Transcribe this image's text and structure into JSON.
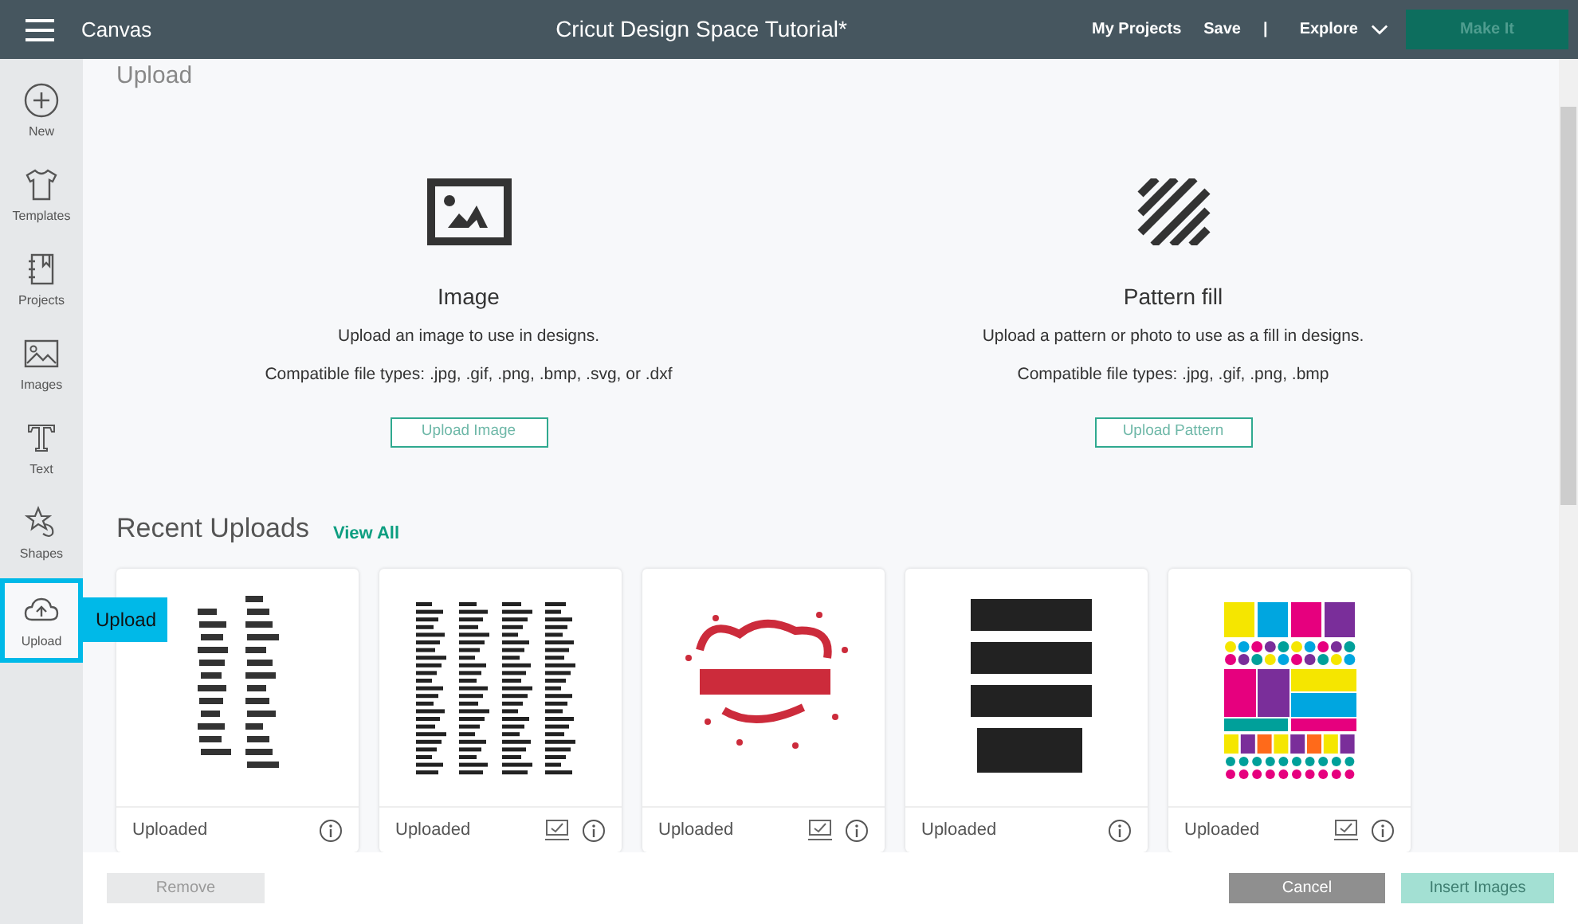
{
  "top_bar": {
    "section": "Canvas",
    "title": "Cricut Design Space Tutorial*",
    "links": [
      "My Projects",
      "Save"
    ],
    "separator": "|",
    "explore": "Explore",
    "make_it": {
      "label": "Make It",
      "disabled": true
    }
  },
  "sidebar": {
    "items": [
      {
        "label": "New",
        "kind": "new",
        "selected": false
      },
      {
        "label": "Templates",
        "kind": "templates",
        "selected": false
      },
      {
        "label": "Projects",
        "kind": "projects",
        "selected": false
      },
      {
        "label": "Images",
        "kind": "images",
        "selected": false
      },
      {
        "label": "Text",
        "kind": "text",
        "selected": false
      },
      {
        "label": "Shapes",
        "kind": "shapes",
        "selected": false
      },
      {
        "label": "Upload",
        "kind": "upload",
        "selected": true
      }
    ],
    "tooltip": "Upload"
  },
  "heading": "Upload",
  "upload_options": [
    {
      "kind": "image",
      "title": "Image",
      "description": "Upload an image to use in designs.",
      "file_types": "Compatible file types: .jpg, .gif, .png, .bmp, .svg, or .dxf",
      "button": "Upload Image"
    },
    {
      "kind": "pattern",
      "title": "Pattern fill",
      "description": "Upload a pattern or photo to use as a fill in designs.",
      "file_types": "Compatible file types: .jpg, .gif, .png, .bmp",
      "button": "Upload Pattern"
    }
  ],
  "recent_uploads": {
    "title": "Recent Uploads",
    "view_all": "View All",
    "items": [
      {
        "kind": "word-list",
        "status": "Uploaded",
        "marked": false
      },
      {
        "kind": "word-columns",
        "status": "Uploaded",
        "marked": true
      },
      {
        "kind": "red-lettering",
        "status": "Uploaded",
        "marked": true
      },
      {
        "kind": "black-lettering",
        "status": "Uploaded",
        "marked": false
      },
      {
        "kind": "stickers",
        "status": "Uploaded",
        "marked": true
      }
    ]
  },
  "footer": {
    "remove": {
      "label": "Remove",
      "disabled": true
    },
    "cancel": {
      "label": "Cancel",
      "disabled": false
    },
    "insert": {
      "label": "Insert Images",
      "disabled": true
    }
  }
}
